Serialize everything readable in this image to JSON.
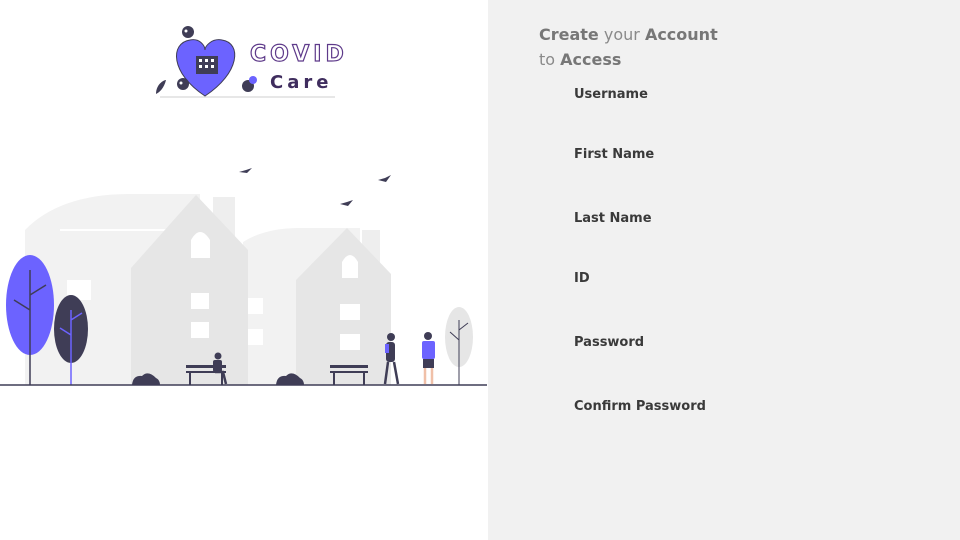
{
  "logo": {
    "word_1": "COVID",
    "word_2": "Care"
  },
  "form": {
    "heading": {
      "line1_bold_a": "Create",
      "line1_light": " your ",
      "line1_bold_b": "Account",
      "line2_light": "to ",
      "line2_bold": "Access"
    },
    "fields": [
      {
        "label": "Username"
      },
      {
        "label": "First Name"
      },
      {
        "label": "Last Name"
      },
      {
        "label": "ID"
      },
      {
        "label": "Password"
      },
      {
        "label": "Confirm Password"
      }
    ]
  },
  "colors": {
    "accent": "#6c63ff",
    "dark": "#3f3d56",
    "panel_bg": "#f1f1f1",
    "building": "#e6e6e6"
  }
}
